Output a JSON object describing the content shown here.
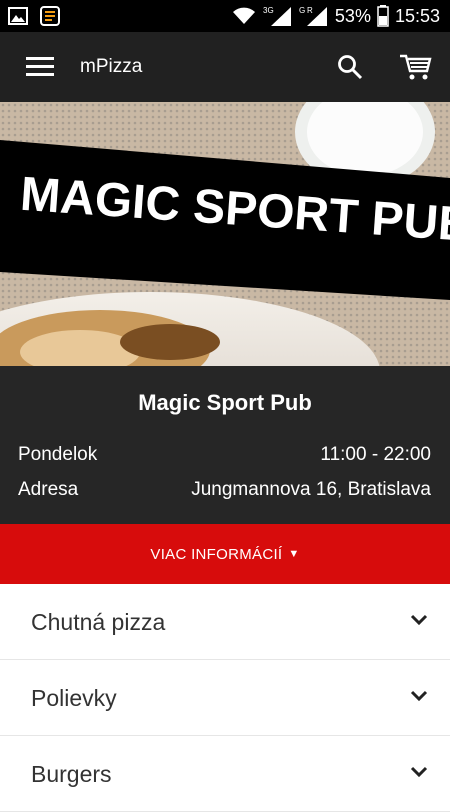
{
  "status_bar": {
    "icons": [
      "image-icon",
      "notification-app-icon",
      "wifi-icon",
      "signal-3g-icon",
      "signal-g-r-icon"
    ],
    "network_labels": [
      "3G",
      "G",
      "R"
    ],
    "battery": "53%",
    "time": "15:53"
  },
  "app_bar": {
    "title": "mPizza",
    "icons": [
      "hamburger-menu-icon",
      "search-icon",
      "cart-icon"
    ]
  },
  "banner": {
    "text": "MAGIC SPORT PUB"
  },
  "restaurant": {
    "name": "Magic Sport Pub",
    "day_label": "Pondelok",
    "hours": "11:00 - 22:00",
    "address_label": "Adresa",
    "address": "Jungmannova 16, Bratislava"
  },
  "more_info": {
    "label": "VIAC INFORMÁCIÍ",
    "arrow": "▼",
    "color": "#d70c0c"
  },
  "categories": [
    {
      "label": "Chutná pizza"
    },
    {
      "label": "Polievky"
    },
    {
      "label": "Burgers"
    }
  ]
}
